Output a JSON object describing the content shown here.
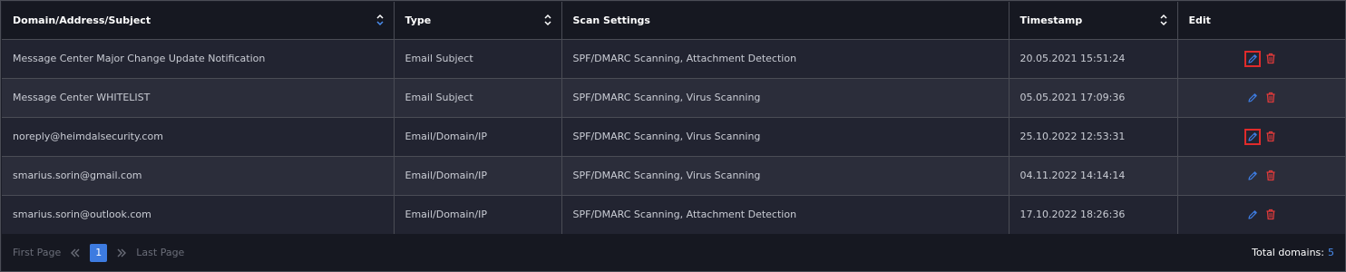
{
  "columns": [
    {
      "label": "Domain/Address/Subject",
      "sortable": true
    },
    {
      "label": "Type",
      "sortable": true
    },
    {
      "label": "Scan Settings",
      "sortable": false
    },
    {
      "label": "Timestamp",
      "sortable": true
    },
    {
      "label": "Edit",
      "sortable": false
    }
  ],
  "rows": [
    {
      "subject": "Message Center Major Change Update Notification",
      "type": "Email Subject",
      "scan": "SPF/DMARC Scanning, Attachment Detection",
      "timestamp": "20.05.2021  15:51:24",
      "edit_highlighted": true
    },
    {
      "subject": "Message Center WHITELIST",
      "type": "Email Subject",
      "scan": "SPF/DMARC Scanning, Virus Scanning",
      "timestamp": "05.05.2021  17:09:36",
      "edit_highlighted": false
    },
    {
      "subject": "noreply@heimdalsecurity.com",
      "type": "Email/Domain/IP",
      "scan": "SPF/DMARC Scanning, Virus Scanning",
      "timestamp": "25.10.2022  12:53:31",
      "edit_highlighted": true
    },
    {
      "subject": "smarius.sorin@gmail.com",
      "type": "Email/Domain/IP",
      "scan": "SPF/DMARC Scanning, Virus Scanning",
      "timestamp": "04.11.2022  14:14:14",
      "edit_highlighted": false
    },
    {
      "subject": "smarius.sorin@outlook.com",
      "type": "Email/Domain/IP",
      "scan": "SPF/DMARC Scanning, Attachment Detection",
      "timestamp": "17.10.2022  18:26:36",
      "edit_highlighted": false
    }
  ],
  "icons": {
    "edit": "pencil-icon",
    "delete": "trash-icon",
    "sort": "sort-arrows-icon",
    "prev": "double-chevron-left-icon",
    "next": "double-chevron-right-icon"
  },
  "colors": {
    "edit_icon": "#3d7be0",
    "delete_icon": "#e03a3a",
    "highlight_box": "#e02b2b",
    "page_active": "#3d7be0"
  },
  "pagination": {
    "first": "First Page",
    "last": "Last Page",
    "current": "1"
  },
  "total": {
    "label": "Total domains:",
    "count": "5"
  }
}
